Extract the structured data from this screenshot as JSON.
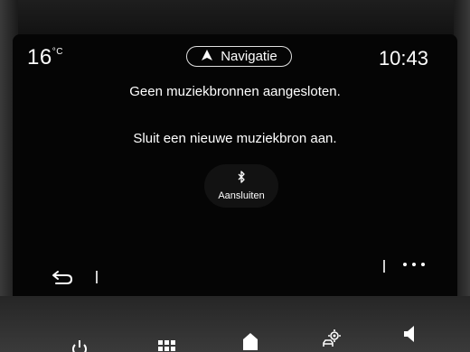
{
  "status_bar": {
    "temperature": "16",
    "temperature_unit": "°C",
    "clock": "10:43",
    "navigation_label": "Navigatie"
  },
  "main": {
    "message_primary": "Geen muziekbronnen aangesloten.",
    "message_secondary": "Sluit een nieuwe muziekbron aan.",
    "connect_label": "Aansluiten",
    "connect_icon": "bluetooth-icon"
  },
  "toolbar": {
    "back_icon": "back-arrow-icon",
    "more_icon": "more-dots-icon"
  },
  "dock": {
    "icons": [
      "power-icon",
      "apps-grid-icon",
      "home-icon",
      "car-settings-icon",
      "volume-icon"
    ]
  },
  "colors": {
    "screen_background": "#050505",
    "text": "#ffffff",
    "bezel": "#2a2a2a"
  }
}
